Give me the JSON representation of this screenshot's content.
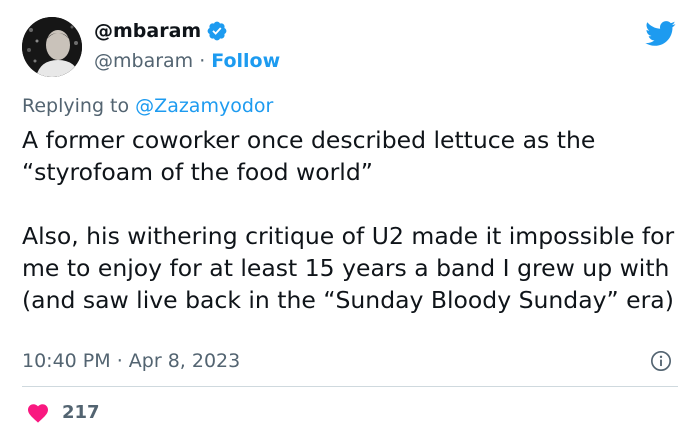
{
  "header": {
    "display_name": "@mbaram",
    "handle": "@mbaram",
    "separator": "·",
    "follow_label": "Follow"
  },
  "reply": {
    "prefix": "Replying to",
    "mention": "@Zazamyodor"
  },
  "body": {
    "paragraph_1": "A former coworker once described lettuce as the “styrofoam of the food world”",
    "paragraph_2": "Also, his withering critique of U2 made it impossible for me to enjoy for at least 15 years a band I grew up with (and saw live back in the “Sunday Bloody Sunday” era)"
  },
  "footer": {
    "time": "10:40 PM",
    "separator": "·",
    "date": "Apr 8, 2023",
    "likes": "217"
  },
  "icons": {
    "verified": "verified-badge-icon",
    "bird": "twitter-bird-icon",
    "info": "info-icon",
    "heart": "heart-icon"
  },
  "colors": {
    "accent": "#1d9bf0",
    "text": "#0f1419",
    "muted": "#536471",
    "heart": "#f91880",
    "divider": "#cfd9de"
  }
}
